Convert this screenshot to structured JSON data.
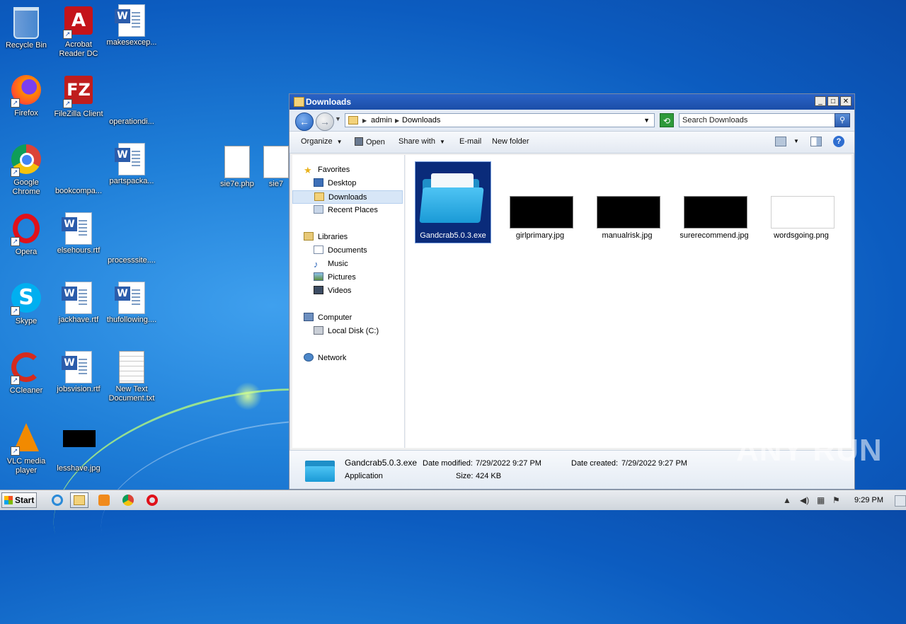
{
  "desktop": {
    "icons": [
      {
        "label": "Recycle Bin"
      },
      {
        "label": "Acrobat Reader DC"
      },
      {
        "label": "makesexcep..."
      },
      {
        "label": "Firefox"
      },
      {
        "label": "FileZilla Client"
      },
      {
        "label": "operationdi..."
      },
      {
        "label": "Google Chrome"
      },
      {
        "label": "bookcompa..."
      },
      {
        "label": "partspacka..."
      },
      {
        "label": "sie7e.php"
      },
      {
        "label": "sie7"
      },
      {
        "label": "Opera"
      },
      {
        "label": "elsehours.rtf"
      },
      {
        "label": "processsite...."
      },
      {
        "label": "Skype"
      },
      {
        "label": "jackhave.rtf"
      },
      {
        "label": "thufollowing...."
      },
      {
        "label": "CCleaner"
      },
      {
        "label": "jobsvision.rtf"
      },
      {
        "label": "New Text Document.txt"
      },
      {
        "label": "VLC media player"
      },
      {
        "label": "lesshave.jpg"
      }
    ]
  },
  "window": {
    "title": "Downloads",
    "buttons": {
      "minimize": "_",
      "maximize": "□",
      "close": "✕"
    },
    "address": {
      "crumbs": [
        "admin",
        "Downloads"
      ]
    },
    "search": {
      "placeholder": "Search Downloads"
    },
    "toolbar": {
      "organize": "Organize",
      "open": "Open",
      "share_with": "Share with",
      "email": "E-mail",
      "new_folder": "New folder"
    },
    "nav": {
      "favorites": "Favorites",
      "desktop": "Desktop",
      "downloads": "Downloads",
      "recent_places": "Recent Places",
      "libraries": "Libraries",
      "documents": "Documents",
      "music": "Music",
      "pictures": "Pictures",
      "videos": "Videos",
      "computer": "Computer",
      "local_disk": "Local Disk (C:)",
      "network": "Network"
    },
    "files": [
      {
        "name": "Gandcrab5.0.3.exe",
        "selected": true
      },
      {
        "name": "girlprimary.jpg"
      },
      {
        "name": "manualrisk.jpg"
      },
      {
        "name": "surerecommend.jpg"
      },
      {
        "name": "wordsgoing.png"
      }
    ],
    "details": {
      "name": "Gandcrab5.0.3.exe",
      "type": "Application",
      "modified_label": "Date modified:",
      "modified_value": "7/29/2022 9:27 PM",
      "created_label": "Date created:",
      "created_value": "7/29/2022 9:27 PM",
      "size_label": "Size:",
      "size_value": "424 KB"
    }
  },
  "taskbar": {
    "start": "Start",
    "clock": "9:29 PM"
  },
  "watermark": "ANY RUN",
  "colors": {
    "accent": "#1b4ea8",
    "selection": "#0a2b7a"
  }
}
